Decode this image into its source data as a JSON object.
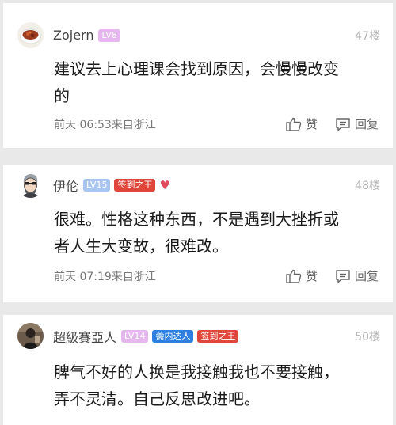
{
  "comments": [
    {
      "name": "Zojern",
      "level": "LV8",
      "level_color": "#e6b6ee",
      "floor": "47楼",
      "text_line1": "建议去上心理课会找到原因，会慢慢改变",
      "text_line2": "的",
      "time": "前天 06:53来自浙江",
      "like_label": "赞",
      "reply_label": "回复"
    },
    {
      "name": "伊伦",
      "level": "LV15",
      "level_color": "#a9c6f2",
      "badge": "签到之王",
      "floor": "48楼",
      "text_line1": "很难。性格这种东西，不是遇到大挫折或",
      "text_line2": "者人生大变故，很难改。",
      "time": "前天 07:19来自浙江",
      "like_label": "赞",
      "reply_label": "回复"
    },
    {
      "name": "超級賽亞人",
      "level": "LV14",
      "level_color": "#e6b6ee",
      "badge_blue": "薷内达人",
      "badge": "签到之王",
      "floor": "50楼",
      "text_line1": "脾气不好的人换是我接触我也不要接触，",
      "text_line2": "弄不灵清。自己反思改进吧。"
    }
  ],
  "colors": {
    "badge_red": "#e0473c",
    "badge_blue": "#2e7fe0",
    "heart": "#e04a5f"
  }
}
